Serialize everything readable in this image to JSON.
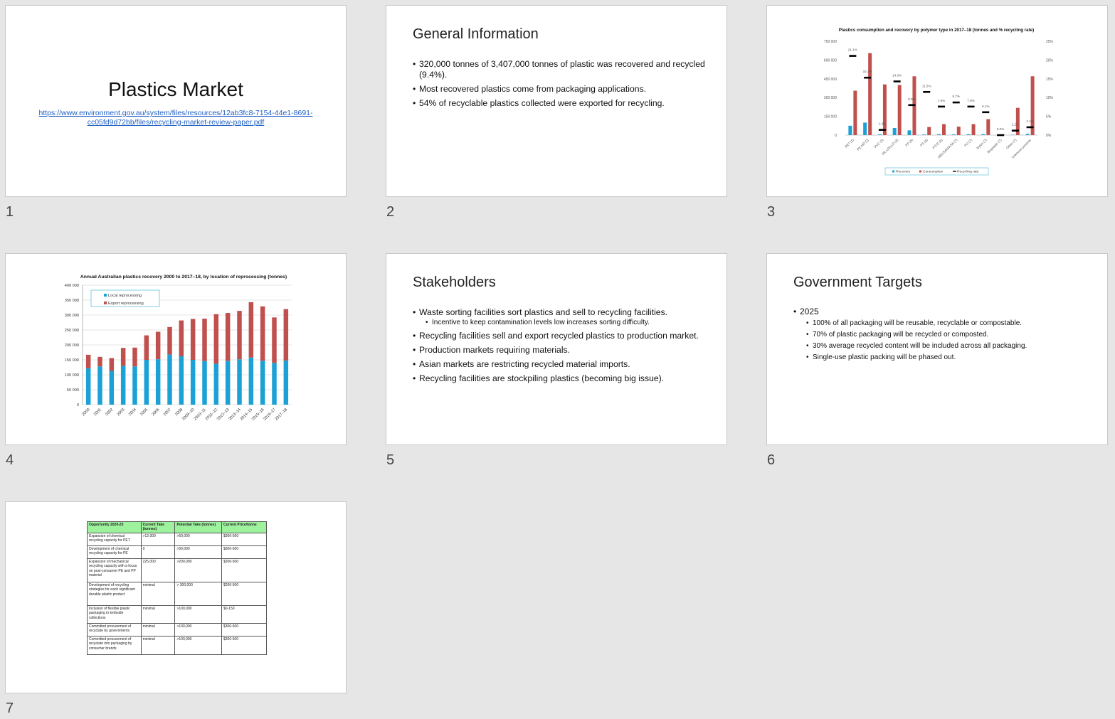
{
  "slide_numbers": [
    "1",
    "2",
    "3",
    "4",
    "5",
    "6",
    "7"
  ],
  "slide1": {
    "title": "Plastics Market",
    "link": "https://www.environment.gov.au/system/files/resources/12ab3fc8-7154-44e1-8691-cc05fd9d72bb/files/recycling-market-review-paper.pdf"
  },
  "slide2": {
    "title": "General Information",
    "bullets": [
      "320,000 tonnes of 3,407,000 tonnes of plastic was recovered and recycled (9.4%).",
      "Most recovered plastics come from packaging applications.",
      "54% of recyclable plastics collected were exported for recycling."
    ]
  },
  "slide5": {
    "title": "Stakeholders",
    "bullets": [
      "Waste sorting facilities sort plastics and sell to recycling facilities.",
      "Incentive to keep contamination levels low increases sorting difficulty.",
      "Recycling facilities sell and export recycled plastics to production market.",
      "Production markets requiring materials.",
      "Asian markets are restricting recycled material imports.",
      "Recycling facilities are stockpiling plastics (becoming big issue)."
    ]
  },
  "slide6": {
    "title": "Government Targets",
    "bullets": [
      "2025",
      "100% of all packaging will be reusable, recyclable or compostable.",
      "70% of plastic packaging will be recycled or composted.",
      "30% average recycled content will be included across all packaging.",
      "Single-use plastic packing will be phased out."
    ]
  },
  "chart_data": [
    {
      "type": "bar",
      "title": "Plastics consumption and recovery by polymer type in 2017–18 (tonnes and % recycling rate)",
      "categories": [
        "PET (1)",
        "PE-HD (2)",
        "PVC (3)",
        "PE-LD/LLD (4)",
        "PP (5)",
        "PS (6)",
        "PS-E (6)",
        "ABS/SAN/ASA (7)",
        "PU (7)",
        "Nylon (7)",
        "Bioplastic (7)",
        "Other (7)",
        "Unknown polymer"
      ],
      "series": [
        {
          "name": "Recovery",
          "color": "#1ba1d6",
          "values": [
            75000,
            100000,
            6000,
            57000,
            38000,
            5000,
            7000,
            6000,
            7000,
            8000,
            0,
            3000,
            10000
          ]
        },
        {
          "name": "Consumption",
          "color": "#c0504d",
          "values": [
            355000,
            655000,
            405000,
            400000,
            470000,
            65000,
            88000,
            68000,
            88000,
            128000,
            5000,
            218000,
            470000
          ]
        },
        {
          "name": "Recycling rate",
          "color": "#000000",
          "values": [
            21.1,
            15.3,
            1.4,
            14.3,
            8.0,
            11.5,
            7.6,
            8.7,
            7.6,
            6.1,
            0.0,
            1.2,
            2.1
          ]
        }
      ],
      "rate_labels": [
        "21.1%",
        "15.3%",
        "1.4%",
        "14.3%",
        "8.0%",
        "11.5%",
        "7.6%",
        "8.7%",
        "7.6%",
        "6.1%",
        "0.0%",
        "1.2%",
        "2.1%"
      ],
      "ylim": [
        0,
        750000
      ],
      "y_ticks": [
        "0",
        "150 000",
        "300 000",
        "450 000",
        "600 000",
        "750 000"
      ],
      "y2lim": [
        0,
        25
      ],
      "y2_ticks": [
        "0%",
        "5%",
        "10%",
        "15%",
        "20%",
        "25%"
      ],
      "legend": "bottom"
    },
    {
      "type": "bar",
      "title": "Annual Australian plastics recovery 2000 to 2017–18, by location of reprocessing (tonnes)",
      "categories": [
        "2000",
        "2001",
        "2002",
        "2003",
        "2004",
        "2005",
        "2006",
        "2007",
        "2008",
        "2009–10",
        "2010–11",
        "2011–12",
        "2012–13",
        "2013–14",
        "2014–15",
        "2015–16",
        "2016–17",
        "2017–18"
      ],
      "stacked": true,
      "series": [
        {
          "name": "Local reprocessing",
          "color": "#1ba1d6",
          "values": [
            122000,
            128000,
            113000,
            130000,
            128000,
            150000,
            152000,
            168000,
            162000,
            150000,
            146000,
            137000,
            147000,
            152000,
            158000,
            147000,
            140000,
            148000
          ]
        },
        {
          "name": "Export reprocessing",
          "color": "#c0504d",
          "values": [
            45000,
            32000,
            43000,
            60000,
            63000,
            82000,
            92000,
            92000,
            120000,
            137000,
            142000,
            166000,
            160000,
            162000,
            185000,
            182000,
            152000,
            172000
          ]
        }
      ],
      "ylim": [
        0,
        400000
      ],
      "y_ticks": [
        "0",
        "50 000",
        "100 000",
        "150 000",
        "200 000",
        "250 000",
        "300 000",
        "350 000",
        "400 000"
      ],
      "grid": true,
      "legend": "top-left"
    }
  ],
  "table": {
    "headers": [
      "Opportunity 2020-25",
      "Current Take (tonnes)",
      "Potential Take (tonnes)",
      "Current Price/tonne"
    ],
    "rows": [
      [
        "Expansion of chemical recycling capacity for PET",
        ">12,000",
        ">50,000",
        "$300-500"
      ],
      [
        "Development of chemical recycling capacity for PE",
        "0",
        ">50,000",
        "$300-500"
      ],
      [
        "Expansion of mechanical recycling capacity with a focus on post-consumer PE and PP material",
        "225,000",
        ">200,000",
        "$200-500"
      ],
      [
        "Development of recycling strategies for each significant durable plastic product",
        "minimal",
        "> 300,000",
        "$200-500"
      ],
      [
        "Inclusion of flexible plastic packaging in kerbside collections",
        "minimal",
        ">100,000",
        "$0-150"
      ],
      [
        "Committed procurement of recyclate by governments",
        "minimal",
        ">100,000",
        "$300-500"
      ],
      [
        "Committed procurement of recyclate into packaging by consumer brands",
        "minimal",
        ">100,000",
        "$300-500"
      ]
    ]
  }
}
